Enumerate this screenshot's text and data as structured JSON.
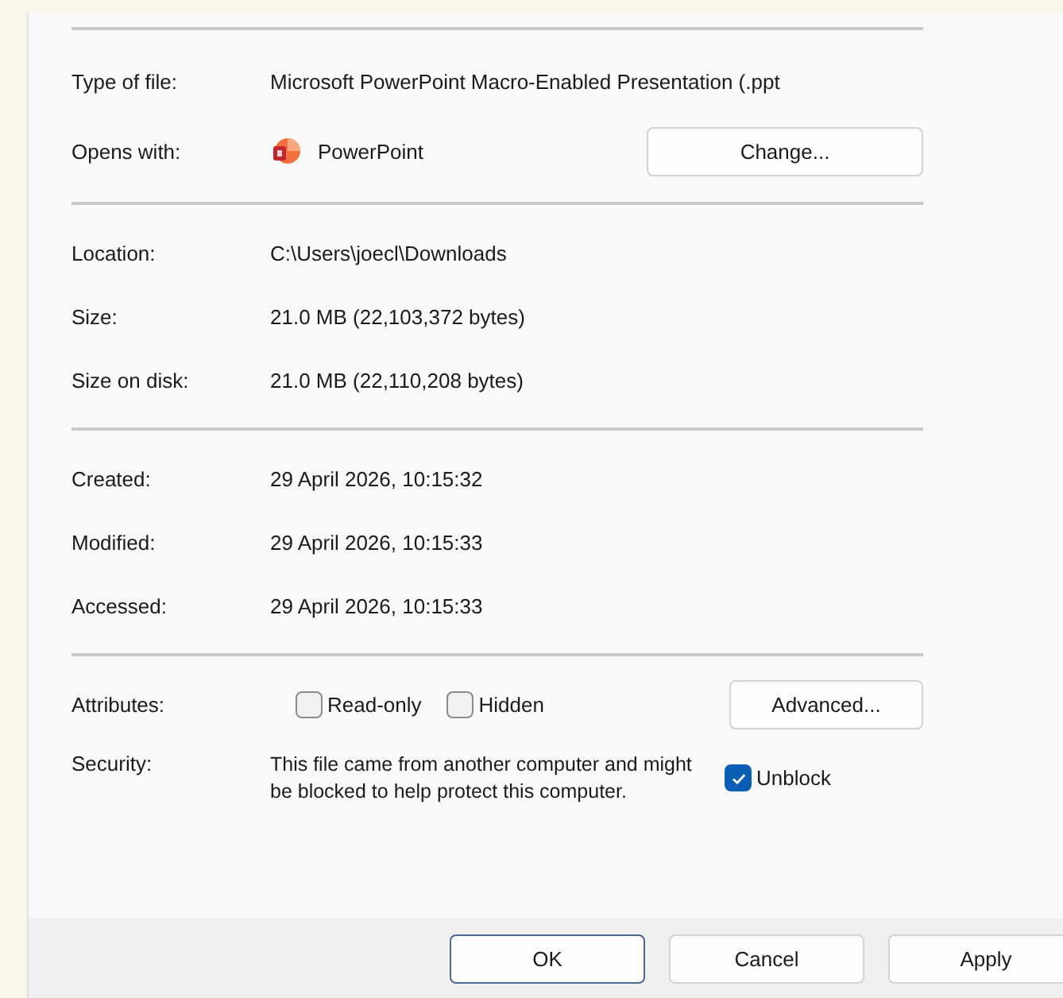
{
  "sections": [
    {
      "rows": [
        {
          "kind": "text",
          "label": "Type of file:",
          "value": "Microsoft PowerPoint Macro-Enabled Presentation (.ppt"
        },
        {
          "kind": "app",
          "label": "Opens with:",
          "value": "PowerPoint",
          "button": "Change..."
        }
      ]
    },
    {
      "rows": [
        {
          "kind": "text",
          "label": "Location:",
          "value": "C:\\Users\\joecl\\Downloads"
        },
        {
          "kind": "text",
          "label": "Size:",
          "value": "21.0 MB (22,103,372 bytes)"
        },
        {
          "kind": "text",
          "label": "Size on disk:",
          "value": "21.0 MB (22,110,208 bytes)"
        }
      ]
    },
    {
      "rows": [
        {
          "kind": "text",
          "label": "Created:",
          "value": "29 April 2026, 10:15:32"
        },
        {
          "kind": "text",
          "label": "Modified:",
          "value": "29 April 2026, 10:15:33"
        },
        {
          "kind": "text",
          "label": "Accessed:",
          "value": "29 April 2026, 10:15:33"
        }
      ]
    },
    {
      "rows": [
        {
          "kind": "checks",
          "label": "Attributes:",
          "checks": [
            {
              "label": "Read-only",
              "checked": false
            },
            {
              "label": "Hidden",
              "checked": false
            }
          ],
          "button": "Advanced..."
        },
        {
          "kind": "security",
          "label": "Security:",
          "value": "This file came from another computer and might be blocked to help protect this computer.",
          "check": {
            "label": "Unblock",
            "checked": true
          }
        }
      ]
    }
  ],
  "buttons": [
    {
      "label": "OK",
      "default": true
    },
    {
      "label": "Cancel",
      "default": false
    },
    {
      "label": "Apply",
      "default": false
    }
  ]
}
